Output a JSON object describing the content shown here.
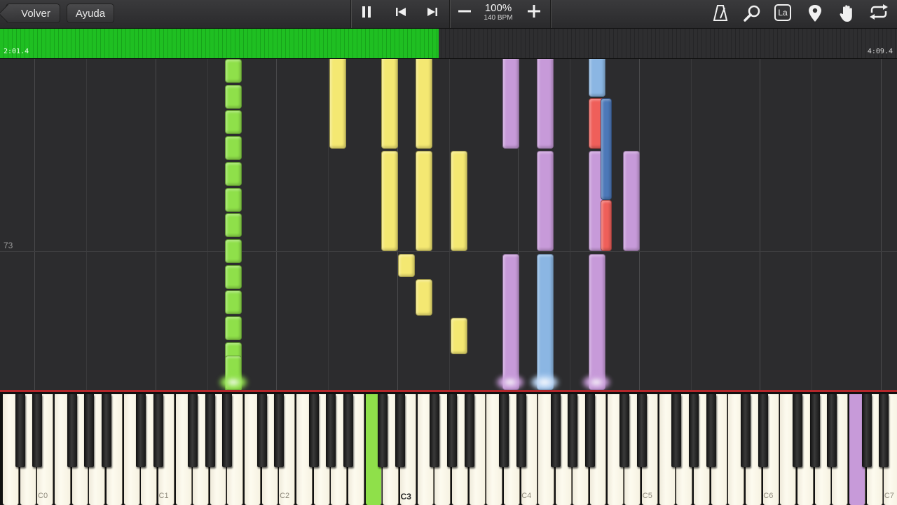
{
  "toolbar": {
    "back_label": "Volver",
    "help_label": "Ayuda",
    "speed_value": "100%",
    "speed_bpm": "140 BPM",
    "icons": [
      "pause-icon",
      "skip-back-icon",
      "skip-forward-icon",
      "minus-icon",
      "plus-icon",
      "metronome-icon",
      "zoom-icon",
      "note-label-icon",
      "location-icon",
      "hand-icon",
      "loop-icon"
    ],
    "note_label_icon_text": "La"
  },
  "progress": {
    "current_time": "2:01.4",
    "total_time": "4:09.4",
    "fraction": 0.489,
    "fill_color": "#1fbf22"
  },
  "roll": {
    "measure_number": "73"
  },
  "keyboard": {
    "octave_labels": [
      "C0",
      "C1",
      "C2",
      "C3",
      "C4",
      "C5",
      "C6",
      "C7"
    ],
    "active_label": "C3"
  },
  "colors": {
    "green": "#8fe04a",
    "yellow": "#f4e872",
    "purple": "#c79ad9",
    "blue": "#8bb6e3",
    "red": "#ef5f5a",
    "dark_blue": "#4c78b8"
  }
}
